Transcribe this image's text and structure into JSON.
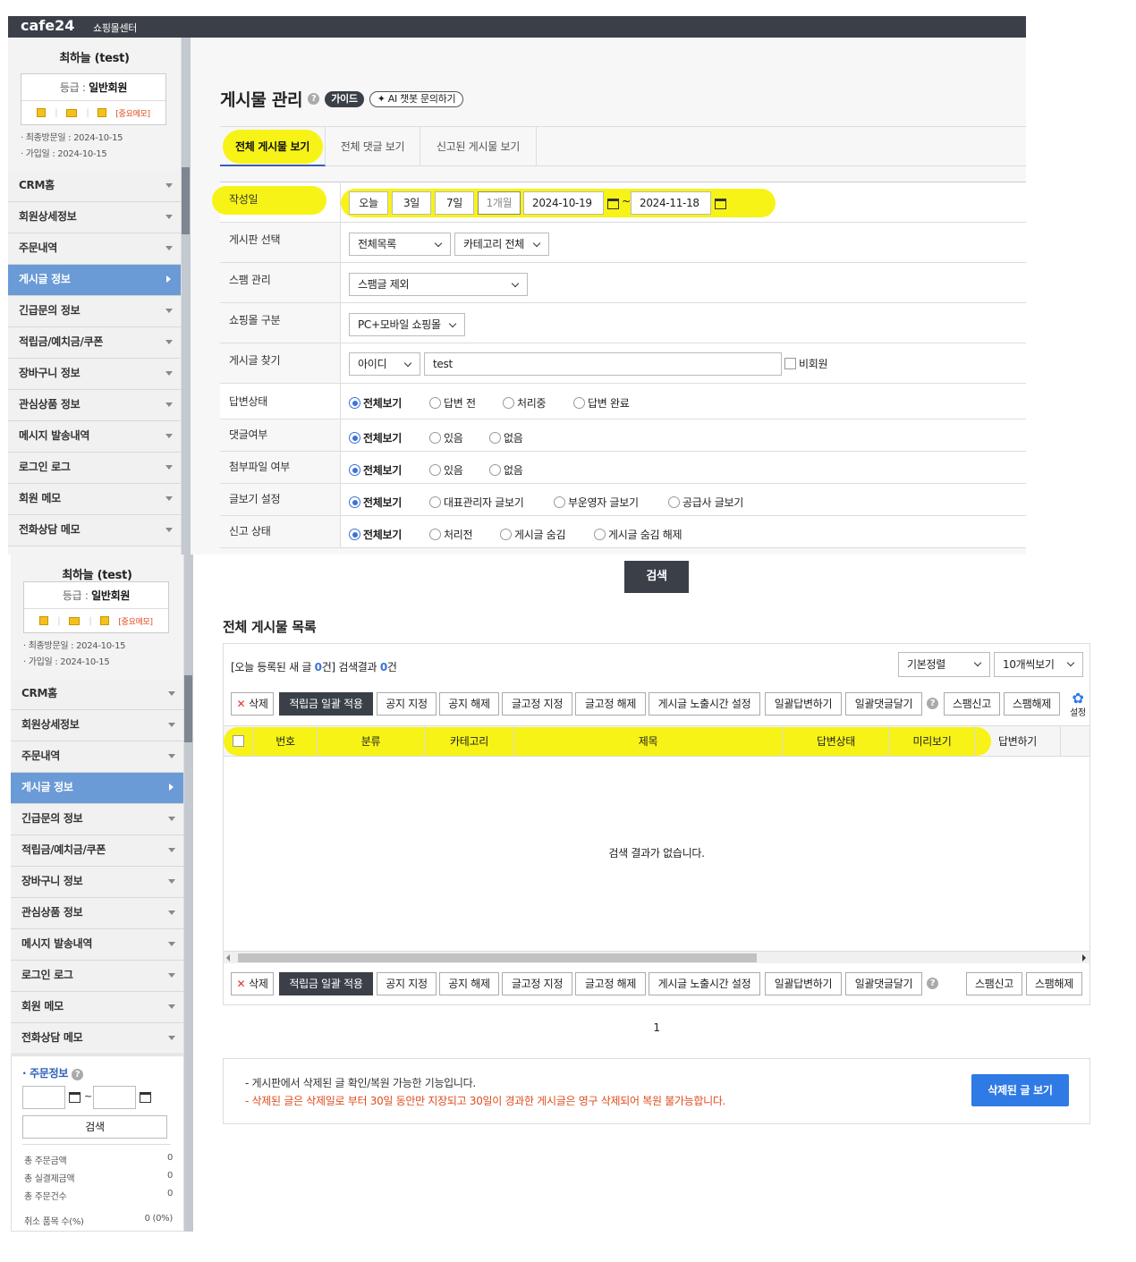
{
  "topbar": {
    "logo": "cafe24",
    "subtitle": "쇼핑몰센터"
  },
  "sidebar": {
    "user_name": "최하늘 (test)",
    "grade_label": "등급 : ",
    "grade_value": "일반회원",
    "important_memo": "[중요메모]",
    "last_visit": "· 최종방문일 : 2024-10-15",
    "joined": "· 가입일 : 2024-10-15",
    "menu": [
      {
        "label": "CRM홈"
      },
      {
        "label": "회원상세정보"
      },
      {
        "label": "주문내역"
      },
      {
        "label": "게시글 정보",
        "active": true
      },
      {
        "label": "긴급문의 정보"
      },
      {
        "label": "적립금/예치금/쿠폰"
      },
      {
        "label": "장바구니 정보"
      },
      {
        "label": "관심상품 정보"
      },
      {
        "label": "메시지 발송내역"
      },
      {
        "label": "로그인 로그"
      },
      {
        "label": "회원 메모"
      },
      {
        "label": "전화상담 메모"
      }
    ],
    "order_info": {
      "title": "주문정보",
      "date_sep": "~",
      "search_label": "검색",
      "stats": [
        {
          "label": "총 주문금액",
          "value": "0"
        },
        {
          "label": "총 실결제금액",
          "value": "0"
        },
        {
          "label": "총 주문건수",
          "value": "0"
        },
        {
          "label": "취소 품목 수(%)",
          "value": "0 (0%)"
        }
      ]
    }
  },
  "page": {
    "title": "게시물 관리",
    "guide_label": "가이드",
    "ai_label": "✦ AI 챗봇 문의하기",
    "tabs": [
      {
        "label": "전체 게시물 보기",
        "active": true
      },
      {
        "label": "전체 댓글 보기"
      },
      {
        "label": "신고된 게시물 보기"
      }
    ]
  },
  "form": {
    "date": {
      "label": "작성일",
      "quick": [
        "오늘",
        "3일",
        "7일",
        "1개월"
      ],
      "active_quick": "1개월",
      "start": "2024-10-19",
      "sep": "~",
      "end": "2024-11-18"
    },
    "board": {
      "label": "게시판 선택",
      "board_value": "전체목록",
      "category_value": "카테고리 전체"
    },
    "spam": {
      "label": "스팸 관리",
      "value": "스팸글 제외"
    },
    "mall": {
      "label": "쇼핑몰 구분",
      "value": "PC+모바일 쇼핑몰"
    },
    "find": {
      "label": "게시글 찾기",
      "field_value": "아이디",
      "keyword": "test",
      "nonmember_label": "비회원"
    },
    "answer": {
      "label": "답변상태",
      "options": [
        "전체보기",
        "답변 전",
        "처리중",
        "답변 완료"
      ],
      "selected": 0
    },
    "comment": {
      "label": "댓글여부",
      "options": [
        "전체보기",
        "있음",
        "없음"
      ],
      "selected": 0
    },
    "attach": {
      "label": "첨부파일 여부",
      "options": [
        "전체보기",
        "있음",
        "없음"
      ],
      "selected": 0
    },
    "author": {
      "label": "글보기 설정",
      "options": [
        "전체보기",
        "대표관리자 글보기",
        "부운영자 글보기",
        "공급사 글보기"
      ],
      "selected": 0
    },
    "report": {
      "label": "신고 상태",
      "options": [
        "전체보기",
        "처리전",
        "게시글 숨김",
        "게시글 숨김 해제"
      ],
      "selected": 0
    },
    "search_button": "검색"
  },
  "list": {
    "title": "전체 게시물 목록",
    "summary_prefix": "[오늘 등록된 새 글 ",
    "today_count": "0",
    "summary_mid": "건] 검색결과 ",
    "result_count": "0",
    "summary_suffix": "건",
    "sort_value": "기본정렬",
    "perpage_value": "10개씩보기",
    "toolbar": {
      "delete": "삭제",
      "apply_points": "적립금 일괄 적용",
      "notice_set": "공지 지정",
      "notice_unset": "공지 해제",
      "pin_set": "글고정 지정",
      "pin_unset": "글고정 해제",
      "exposure_time": "게시글 노출시간 설정",
      "bulk_answer": "일괄답변하기",
      "bulk_comment": "일괄댓글달기",
      "spam_report": "스팸신고",
      "spam_release": "스팸해제",
      "settings": "설정"
    },
    "columns": [
      "번호",
      "분류",
      "카테고리",
      "제목",
      "답변상태",
      "미리보기",
      "답변하기"
    ],
    "empty_message": "검색 결과가 없습니다.",
    "page": "1"
  },
  "notice": {
    "line1": "- 게시판에서 삭제된 글 확인/복원 가능한 기능입니다.",
    "line2": "- 삭제된 글은 삭제일로 부터 30일 동안만 지장되고 30일이 경과한 게시글은 영구 삭제되어 복원 불가능합니다.",
    "button": "삭제된 글 보기"
  },
  "colors": {
    "accent": "#3b72d9",
    "dark": "#3b4048",
    "highlight": "#f7f20a",
    "warning": "#e04b1c",
    "primary_button": "#2f7ae5",
    "active_menu": "#6b9bd6"
  }
}
